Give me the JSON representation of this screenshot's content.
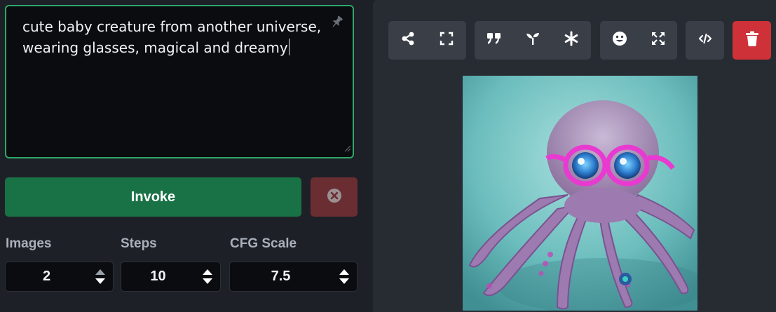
{
  "prompt": {
    "text": "cute baby creature from another universe,\nwearing glasses, magical and dreamy"
  },
  "actions": {
    "invoke_label": "Invoke"
  },
  "params": {
    "images": {
      "label": "Images",
      "value": "2"
    },
    "steps": {
      "label": "Steps",
      "value": "10"
    },
    "cfg_scale": {
      "label": "CFG Scale",
      "value": "7.5"
    }
  },
  "toolbar": {
    "groups": [
      [
        "share-icon",
        "fullscreen-icon"
      ],
      [
        "quote-icon",
        "sprout-icon",
        "asterisk-icon"
      ],
      [
        "face-icon",
        "expand-icon"
      ],
      [
        "code-icon"
      ]
    ],
    "delete_icon": "trash-icon"
  },
  "preview": {
    "image_subject": "octopus-with-glasses"
  },
  "colors": {
    "accent_green": "#197146",
    "prompt_border": "#2ea86a",
    "cancel_bg": "#6a2e32",
    "delete_bg": "#cf3138",
    "toolbar_bg": "#393e47"
  }
}
